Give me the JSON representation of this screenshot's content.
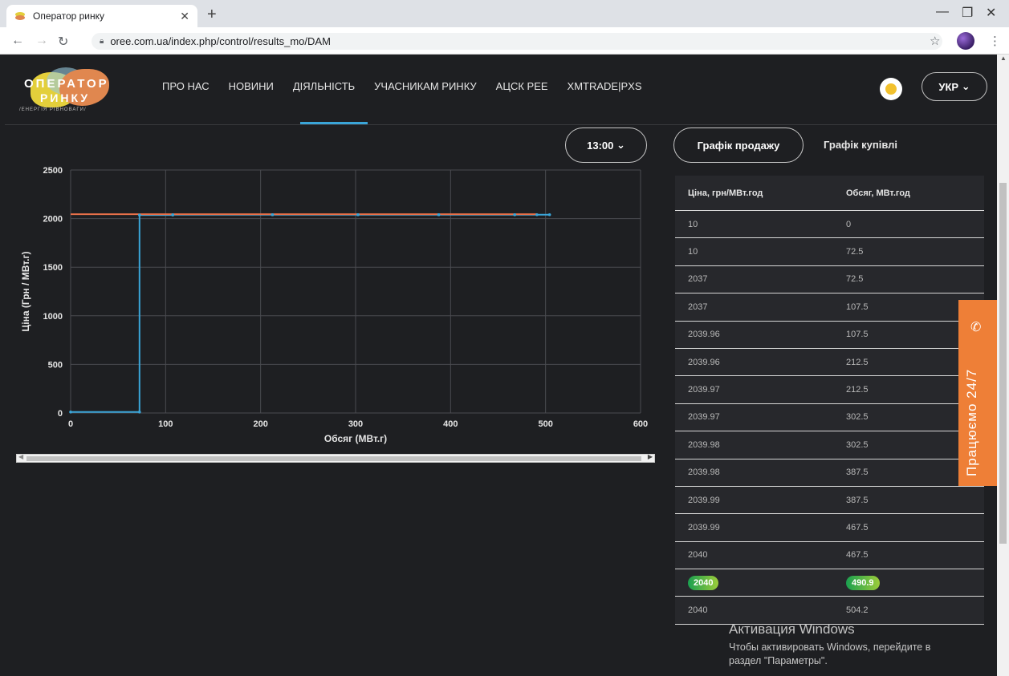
{
  "browser": {
    "tab_title": "Оператор ринку",
    "url": "oree.com.ua/index.php/control/results_mo/DAM"
  },
  "site": {
    "logo_line1": "ОПЕРАТОР",
    "logo_line2": "РИНКУ",
    "logo_tagline": "/ЕНЕРГІЯ РІВНОВАГИ/",
    "nav": [
      "ПРО НАС",
      "НОВИНИ",
      "ДІЯЛЬНІСТЬ",
      "УЧАСНИКАМ РИНКУ",
      "АЦСК РЕЕ",
      "XMTRADE|PXS"
    ],
    "lang": "УКР"
  },
  "controls": {
    "time": "13:00",
    "tab_sell": "Графік продажу",
    "tab_buy": "Графік купівлі"
  },
  "chart_data": {
    "type": "line",
    "title": "",
    "xlabel": "Обсяг (МВт.г)",
    "ylabel": "Ціна (Грн / МВт.г)",
    "xlim": [
      0,
      600
    ],
    "ylim": [
      0,
      2500
    ],
    "x_ticks": [
      "0",
      "100",
      "200",
      "300",
      "400",
      "500",
      "600"
    ],
    "y_ticks": [
      "0",
      "500",
      "1000",
      "1500",
      "2000",
      "2500"
    ],
    "grid": true,
    "series": [
      {
        "color": "#3aa5d8",
        "points": [
          [
            0,
            10
          ],
          [
            72.5,
            10
          ],
          [
            72.5,
            2037
          ],
          [
            107.5,
            2037
          ],
          [
            107.5,
            2039.96
          ],
          [
            212.5,
            2039.96
          ],
          [
            212.5,
            2039.97
          ],
          [
            302.5,
            2039.97
          ],
          [
            302.5,
            2039.98
          ],
          [
            387.5,
            2039.98
          ],
          [
            387.5,
            2039.99
          ],
          [
            467.5,
            2039.99
          ],
          [
            467.5,
            2040
          ],
          [
            490.9,
            2040
          ],
          [
            504.2,
            2040
          ]
        ]
      },
      {
        "color": "#e8704a",
        "points": [
          [
            0,
            2045
          ],
          [
            490.9,
            2045
          ]
        ]
      }
    ]
  },
  "table": {
    "headers": [
      "Ціна, грн/МВт.год",
      "Обсяг, МВт.год"
    ],
    "rows": [
      [
        "10",
        "0"
      ],
      [
        "10",
        "72.5"
      ],
      [
        "2037",
        "72.5"
      ],
      [
        "2037",
        "107.5"
      ],
      [
        "2039.96",
        "107.5"
      ],
      [
        "2039.96",
        "212.5"
      ],
      [
        "2039.97",
        "212.5"
      ],
      [
        "2039.97",
        "302.5"
      ],
      [
        "2039.98",
        "302.5"
      ],
      [
        "2039.98",
        "387.5"
      ],
      [
        "2039.99",
        "387.5"
      ],
      [
        "2039.99",
        "467.5"
      ],
      [
        "2040",
        "467.5"
      ],
      [
        "2040",
        "490.9"
      ],
      [
        "2040",
        "504.2"
      ]
    ],
    "highlight_row": 13
  },
  "support": "Працюємо 24/7",
  "activation": {
    "title": "Активация Windows",
    "line1": "Чтобы активировать Windows, перейдите в",
    "line2": "раздел \"Параметры\"."
  },
  "colors": {
    "background": "#1e1f22",
    "accent_blue": "#3aa5d8",
    "accent_orange": "#ee7f37"
  }
}
